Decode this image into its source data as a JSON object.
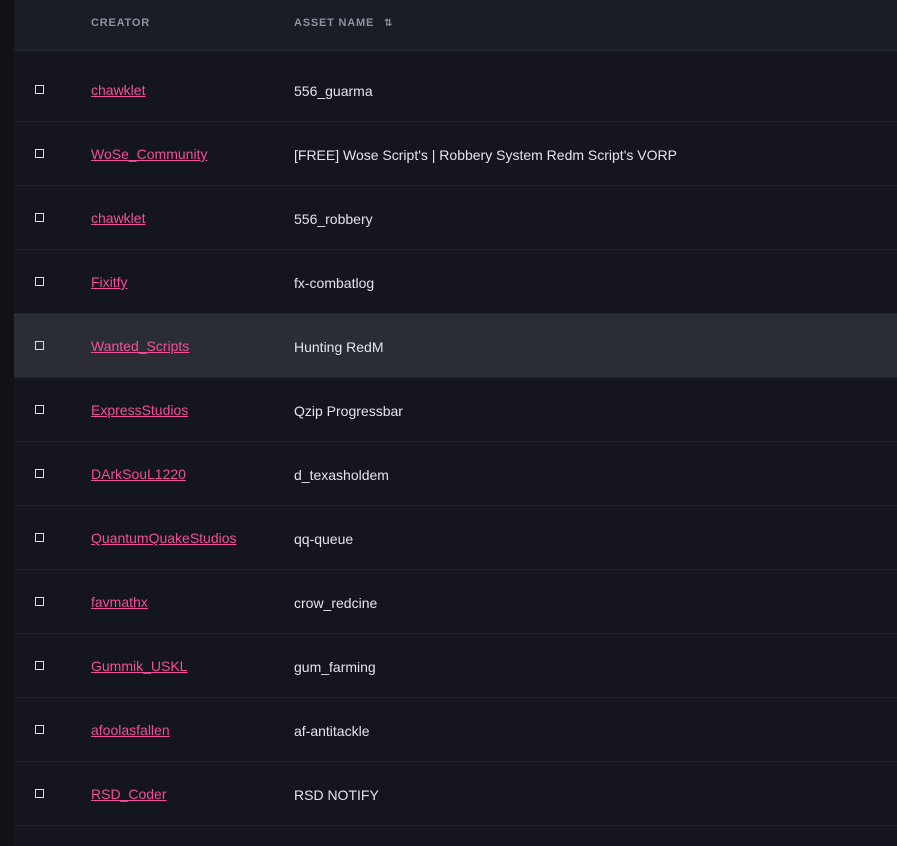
{
  "header": {
    "creator": "CREATOR",
    "asset_name": "ASSET NAME",
    "sort_icon": "⇅"
  },
  "rows": [
    {
      "creator": "chawklet",
      "asset": "556_guarma"
    },
    {
      "creator": "WoSe_Community",
      "asset": "[FREE] Wose Script's | Robbery System Redm Script's VORP"
    },
    {
      "creator": "chawklet",
      "asset": "556_robbery"
    },
    {
      "creator": "Fixitfy",
      "asset": "fx-combatlog"
    },
    {
      "creator": "Wanted_Scripts",
      "asset": "Hunting RedM"
    },
    {
      "creator": "ExpressStudios",
      "asset": "Qzip Progressbar"
    },
    {
      "creator": "DArkSouL1220",
      "asset": "d_texasholdem"
    },
    {
      "creator": "QuantumQuakeStudios",
      "asset": "qq-queue"
    },
    {
      "creator": "favmathx",
      "asset": "crow_redcine"
    },
    {
      "creator": "Gummik_USKL",
      "asset": "gum_farming"
    },
    {
      "creator": "afoolasfallen",
      "asset": "af-antitackle"
    },
    {
      "creator": "RSD_Coder",
      "asset": "RSD NOTIFY"
    }
  ],
  "colors": {
    "link": "#f0509a",
    "text": "#e3e5ea",
    "header_text": "#8a93a8",
    "highlight_row": "#2b2d35"
  },
  "highlighted_row_index": 4
}
